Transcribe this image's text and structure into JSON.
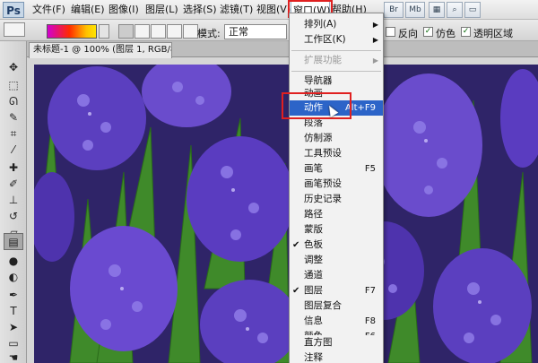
{
  "menubar": {
    "logo": "Ps",
    "items": [
      "文件(F)",
      "编辑(E)",
      "图像(I)",
      "图层(L)",
      "选择(S)",
      "滤镜(T)",
      "视图(V)",
      "窗口(W)",
      "帮助(H)"
    ],
    "badges": [
      "Br",
      "Mb"
    ]
  },
  "options": {
    "mode_label": "模式:",
    "mode_value": "正常",
    "reverse_label": "反向",
    "dither_label": "仿色",
    "transparency_label": "透明区域"
  },
  "document": {
    "tab_title": "未标题-1 @ 100% (图层 1, RGB/8) *"
  },
  "window_menu": {
    "items": [
      {
        "label": "排列(A)",
        "shortcut": "",
        "submenu": true,
        "checked": false,
        "disabled": false
      },
      {
        "label": "工作区(K)",
        "shortcut": "",
        "submenu": true,
        "checked": false,
        "disabled": false
      },
      {
        "label": "扩展功能",
        "shortcut": "",
        "submenu": true,
        "checked": false,
        "disabled": true
      },
      {
        "label": "导航器",
        "shortcut": "",
        "submenu": false,
        "checked": false,
        "disabled": false
      },
      {
        "label": "动画",
        "shortcut": "",
        "submenu": false,
        "checked": false,
        "disabled": false
      },
      {
        "label": "动作",
        "shortcut": "Alt+F9",
        "submenu": false,
        "checked": false,
        "disabled": false,
        "highlighted": true
      },
      {
        "label": "段落",
        "shortcut": "",
        "submenu": false,
        "checked": false,
        "disabled": false
      },
      {
        "label": "仿制源",
        "shortcut": "",
        "submenu": false,
        "checked": false,
        "disabled": false
      },
      {
        "label": "工具预设",
        "shortcut": "",
        "submenu": false,
        "checked": false,
        "disabled": false
      },
      {
        "label": "画笔",
        "shortcut": "F5",
        "submenu": false,
        "checked": false,
        "disabled": false
      },
      {
        "label": "画笔预设",
        "shortcut": "",
        "submenu": false,
        "checked": false,
        "disabled": false
      },
      {
        "label": "历史记录",
        "shortcut": "",
        "submenu": false,
        "checked": false,
        "disabled": false
      },
      {
        "label": "路径",
        "shortcut": "",
        "submenu": false,
        "checked": false,
        "disabled": false
      },
      {
        "label": "蒙版",
        "shortcut": "",
        "submenu": false,
        "checked": false,
        "disabled": false
      },
      {
        "label": "色板",
        "shortcut": "",
        "submenu": false,
        "checked": true,
        "disabled": false
      },
      {
        "label": "调整",
        "shortcut": "",
        "submenu": false,
        "checked": false,
        "disabled": false
      },
      {
        "label": "通道",
        "shortcut": "",
        "submenu": false,
        "checked": false,
        "disabled": false
      },
      {
        "label": "图层",
        "shortcut": "F7",
        "submenu": false,
        "checked": true,
        "disabled": false
      },
      {
        "label": "图层复合",
        "shortcut": "",
        "submenu": false,
        "checked": false,
        "disabled": false
      },
      {
        "label": "信息",
        "shortcut": "F8",
        "submenu": false,
        "checked": false,
        "disabled": false
      },
      {
        "label": "颜色",
        "shortcut": "F6",
        "submenu": false,
        "checked": false,
        "disabled": false
      },
      {
        "label": "样式",
        "shortcut": "",
        "submenu": false,
        "checked": false,
        "disabled": false
      },
      {
        "label": "直方图",
        "shortcut": "",
        "submenu": false,
        "checked": false,
        "disabled": false
      },
      {
        "label": "注释",
        "shortcut": "",
        "submenu": false,
        "checked": false,
        "disabled": false
      }
    ]
  },
  "tools": [
    "move-icon",
    "marquee-icon",
    "lasso-icon",
    "quick-select-icon",
    "crop-icon",
    "eyedropper-icon",
    "healing-icon",
    "brush-icon",
    "stamp-icon",
    "history-brush-icon",
    "eraser-icon",
    "gradient-icon",
    "blur-icon",
    "dodge-icon",
    "pen-icon",
    "type-icon",
    "path-select-icon",
    "shape-icon",
    "hand-icon"
  ],
  "colors": {
    "highlight": "#2c64c8",
    "annotation_red": "#e02020",
    "flower": "#5b3fbf",
    "leaf": "#3f8a2a"
  }
}
